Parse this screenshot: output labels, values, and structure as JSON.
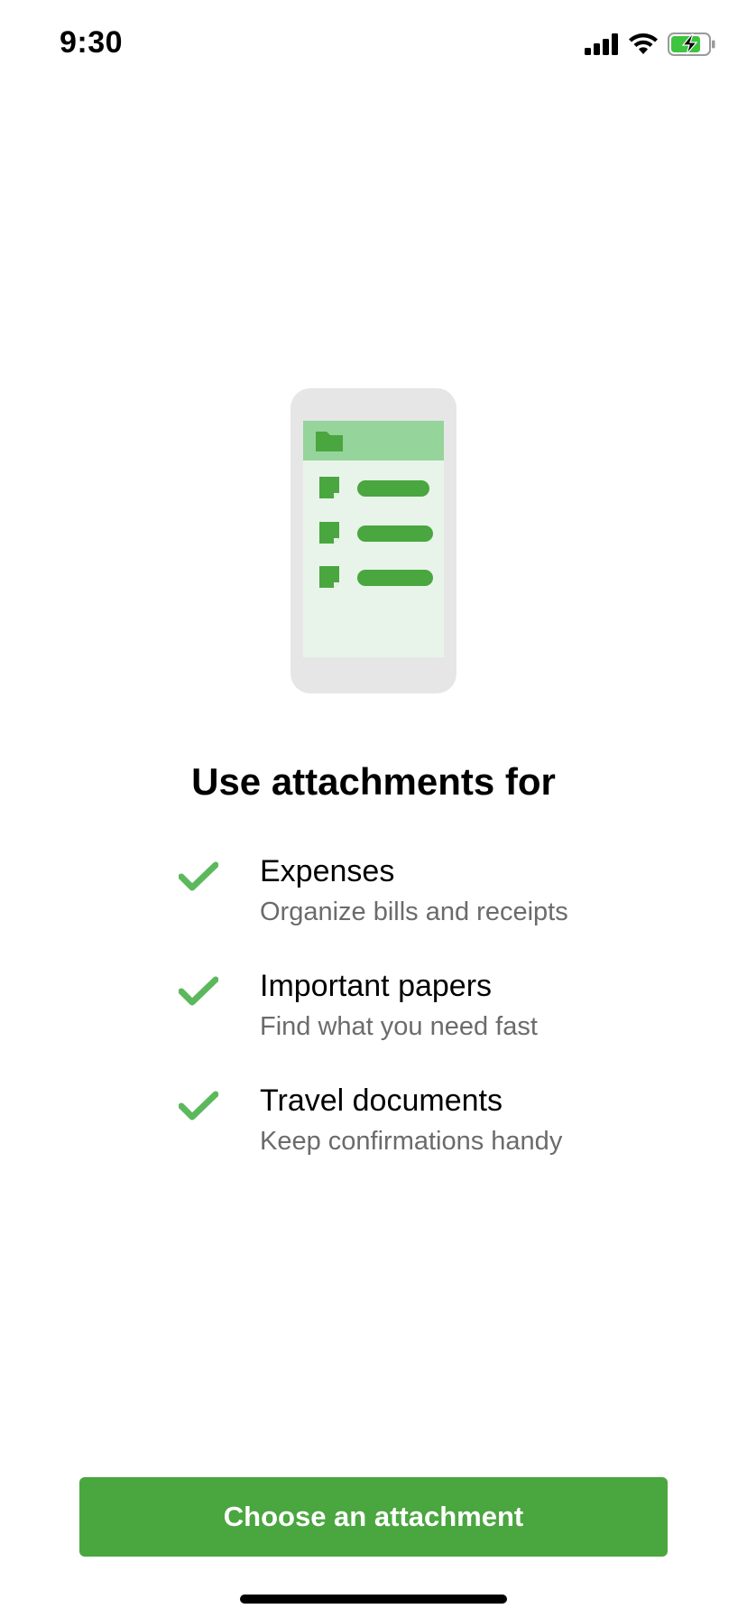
{
  "status_bar": {
    "time": "9:30",
    "icons": [
      "cellular-signal-icon",
      "wifi-icon",
      "battery-charging-icon"
    ]
  },
  "illustration": {
    "icon": "phone-attachments-illustration"
  },
  "heading": "Use attachments for",
  "features": [
    {
      "title": "Expenses",
      "subtitle": "Organize bills and receipts",
      "icon": "checkmark-icon"
    },
    {
      "title": "Important papers",
      "subtitle": "Find what you need fast",
      "icon": "checkmark-icon"
    },
    {
      "title": "Travel documents",
      "subtitle": "Keep confirmations handy",
      "icon": "checkmark-icon"
    }
  ],
  "cta": {
    "label": "Choose an attachment"
  },
  "colors": {
    "accent": "#4aa63f",
    "check": "#5cb85c",
    "illustration_bar": "#95d49b",
    "illustration_screen": "#e8f4e9",
    "illustration_body": "#e6e6e6"
  }
}
